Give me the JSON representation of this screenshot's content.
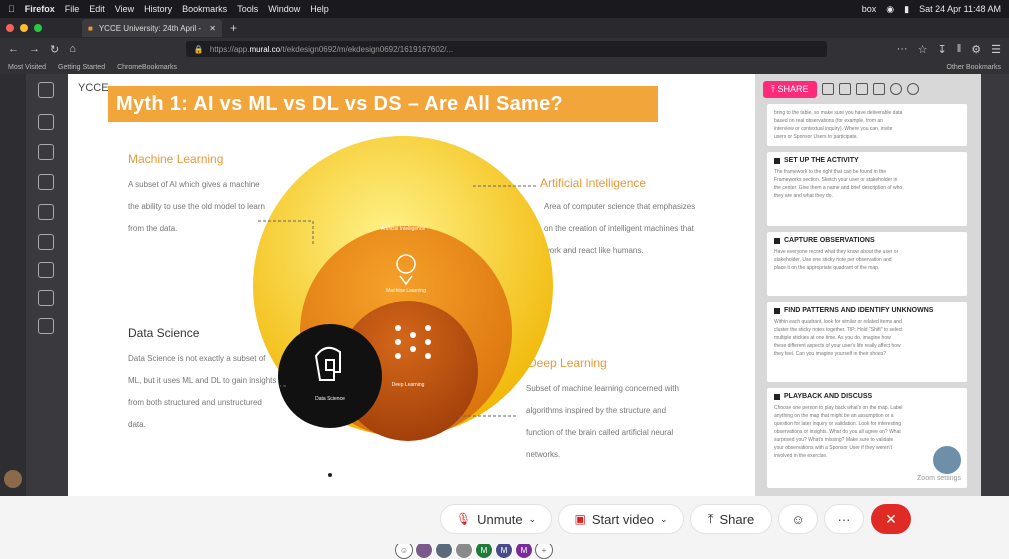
{
  "menubar": {
    "items": [
      "Firefox",
      "File",
      "Edit",
      "View",
      "History",
      "Bookmarks",
      "Tools",
      "Window",
      "Help"
    ],
    "status_box": "box",
    "clock": "Sat 24 Apr 11:48 AM"
  },
  "tab": {
    "title": "YCCE University: 24th April -"
  },
  "navbar": {
    "url_prefix": "https://app.",
    "url_domain": "mural.co",
    "url_rest": "/t/ekdesign0692/m/ekdesign0692/1619167602/..."
  },
  "bookmarks": {
    "most_visited": "Most Visited",
    "getting_started": "Getting Started",
    "chrome_bookmarks": "ChromeBookmarks",
    "other": "Other Bookmarks"
  },
  "board": {
    "header": "YCCE"
  },
  "slide": {
    "title": "Myth 1: AI vs ML vs DL vs DS – Are All Same?",
    "ml_heading": "Machine Learning",
    "ml_body": "A subset of AI which gives a machine the ability to use the old model to learn from the data.",
    "ai_heading": "Artificial Intelligence",
    "ai_body": "Area of computer science that emphasizes on the creation of intelligent machines that work and react like humans.",
    "ds_heading": "Data Science",
    "ds_body": "Data Science is not exactly a subset of ML, but it uses ML and DL to gain insights from both structured and unstructured data.",
    "dl_heading": "Deep Learning",
    "dl_body": "Subset of machine learning concerned with algorithms inspired by the structure and function of the brain called artificial neural networks.",
    "circle_ai": "Artificial Intelligence",
    "circle_ml": "Machine Learning",
    "circle_dl": "Deep Learning",
    "circle_ds": "Data Science"
  },
  "rightpanel": {
    "share_label": "SHARE",
    "cards": [
      {
        "heading": "",
        "body": "bring to the table, so make sure you have deliverable data based on real observations (for example, from an interview or contextual inquiry). Where you can, invite users or Sponsor Users to participate."
      },
      {
        "heading": "SET UP THE ACTIVITY",
        "body": "The framework to the right that can be found in the Frameworks section. Sketch your user or stakeholder in the center. Give them a name and brief description of who they are and what they do."
      },
      {
        "heading": "CAPTURE OBSERVATIONS",
        "body": "Have everyone record what they know about the user or stakeholder. Use one sticky note per observation and place it on the appropriate quadrant of the map."
      },
      {
        "heading": "FIND PATTERNS AND IDENTIFY UNKNOWNS",
        "body": "Within each quadrant, look for similar or related items and cluster the sticky notes together. TIP: Hold \"Shift\" to select multiple stickies at one time. As you do, imagine how these different aspects of your user's life really affect how they feel. Can you imagine yourself in their shoes?"
      },
      {
        "heading": "PLAYBACK AND DISCUSS",
        "body": "Choose one person to play back what's on the map. Label anything on the map that might be an assumption or a question for later inquiry or validation. Look for interesting observations or insights. What do you all agree on? What surprised you? What's missing? Make sure to validate your observations with a Sponsor User if they weren't involved in the exercise."
      }
    ],
    "zoom_settings": "Zoom settings"
  },
  "participants": [
    "M",
    "M",
    "M"
  ],
  "zoombar": {
    "unmute": "Unmute",
    "start_video": "Start video",
    "share": "Share",
    "more": "···"
  }
}
